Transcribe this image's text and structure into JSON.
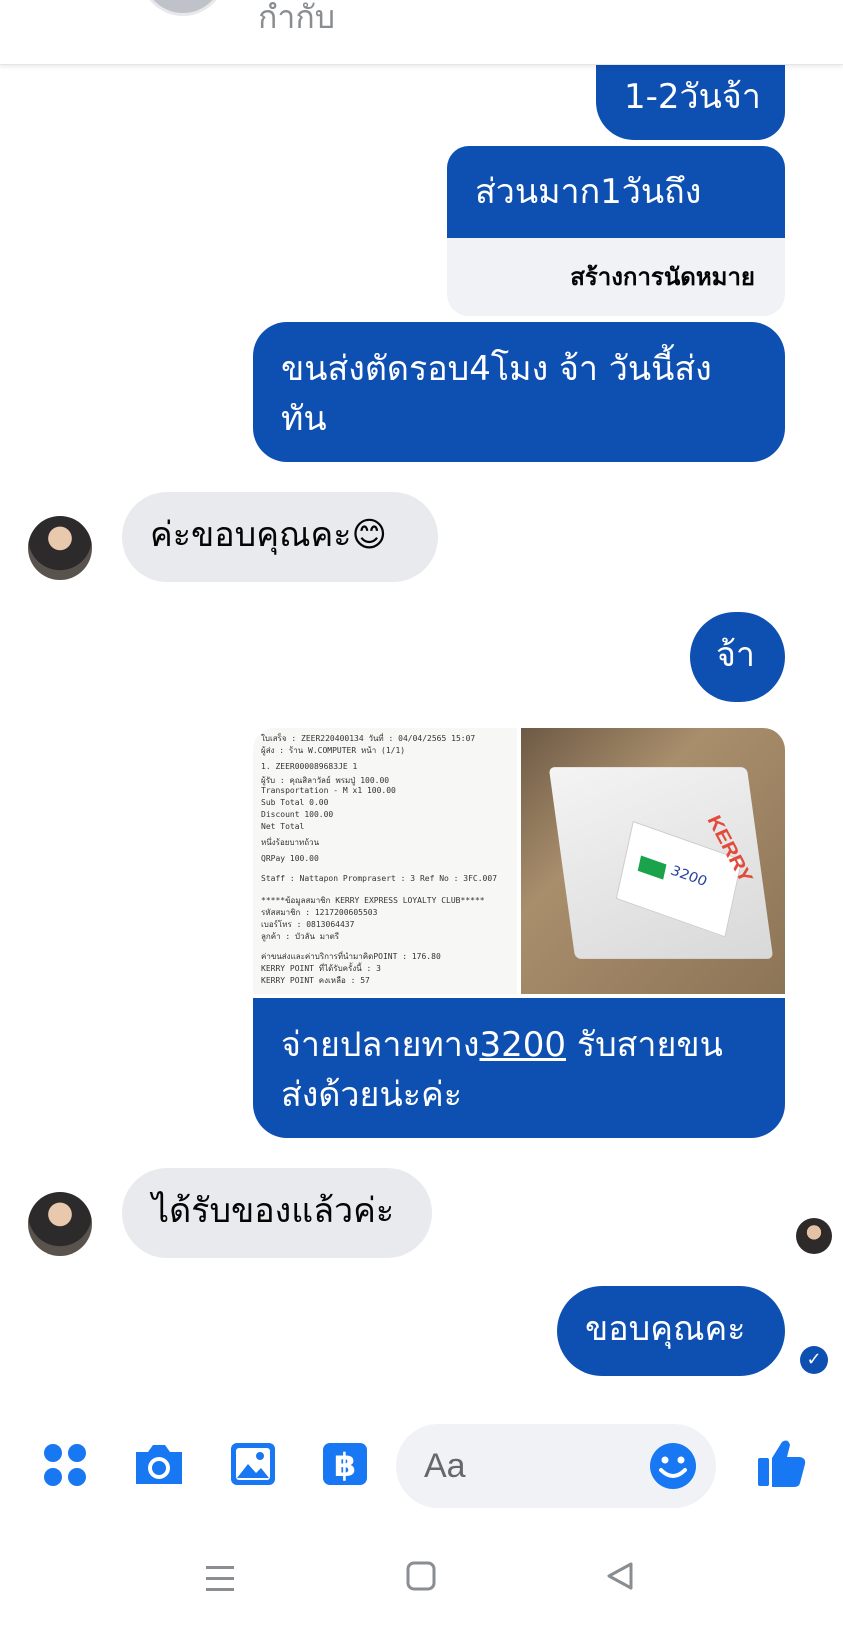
{
  "header": {
    "subtitle": "กำกับ"
  },
  "messages": {
    "m1": "1-2วันจ้า",
    "m2_top": "ส่วนมาก1วันถึง",
    "m2_action": "สร้างการนัดหมาย",
    "m3_line1": "ขนส่งตัดรอบ4โมง   จ้า วันนี้ส่ง",
    "m3_line2": "ทัน",
    "m4": "ค่ะขอบคุณคะ😊",
    "m5": "จ้า",
    "m6_pre": "จ่ายปลายทาง",
    "m6_num": "3200",
    "m6_post": " รับสายขน",
    "m6_line2": "ส่งด้วยน่ะค่ะ",
    "m7": "ได้รับของแล้วค่ะ",
    "m8": "ขอบคุณคะ"
  },
  "receipt": {
    "lines": [
      "ใบเสร็จ : ZEER220400134        วันที่ : 04/04/2565 15:07",
      "ผู้ส่ง : ร้าน W.COMPUTER                    หน้า (1/1)",
      "1. ZEER000089683JE                    1",
      "  ผู้รับ : คุณสิลาวัลย์ พรมปู่               100.00",
      "  Transportation - M x1             100.00",
      "Sub Total                            0.00",
      "Discount                           100.00",
      "Net Total",
      "                          หนึ่งร้อยบาทถ้วน",
      "QRPay                              100.00",
      "Staff : Nattapon Promprasert : 3   Ref No : 3FC.007",
      "*****ข้อมูลสมาชิก KERRY EXPRESS LOYALTY CLUB*****",
      "รหัสสมาชิก : 1217200605503",
      "เบอร์โทร : 0813064437",
      "ลูกค้า : บัวลัน มาตรี",
      "ค่าขนส่งและค่าบริการที่นำมาคิดPOINT : 176.80",
      "KERRY POINT ที่ได้รับครั้งนี้ : 3",
      "KERRY POINT คงเหลือ : 57"
    ]
  },
  "parcel": {
    "brand": "KERRY",
    "note": "3200"
  },
  "composer": {
    "placeholder": "Aa"
  },
  "colors": {
    "accent": "#0e4fb2",
    "incoming": "#e9eaed",
    "icon": "#1877f2"
  }
}
